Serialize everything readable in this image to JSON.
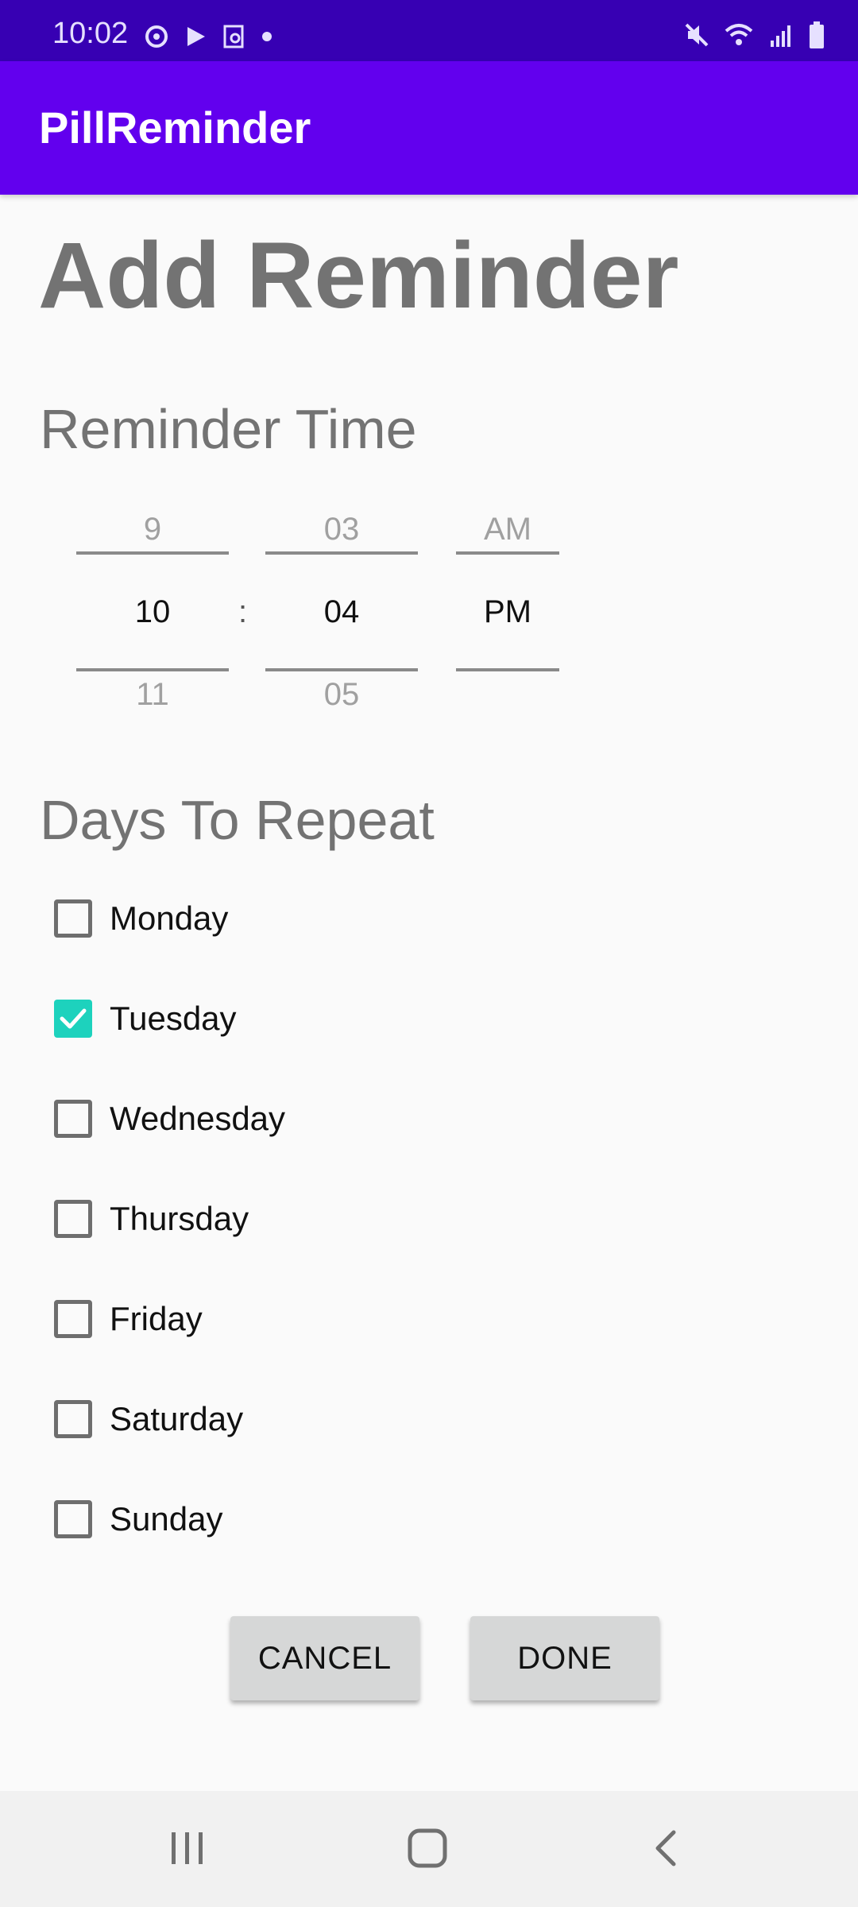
{
  "status_bar": {
    "time": "10:02",
    "icons_left": [
      "sync-icon",
      "play-store-icon",
      "screenshot-icon",
      "notification-dot-icon"
    ],
    "icons_right": [
      "mute-icon",
      "wifi-icon",
      "signal-icon",
      "battery-icon"
    ]
  },
  "app_bar": {
    "title": "PillReminder"
  },
  "page": {
    "title": "Add Reminder"
  },
  "reminder_time": {
    "section_title": "Reminder Time",
    "hour": {
      "prev": "9",
      "current": "10",
      "next": "11"
    },
    "separator": ":",
    "minute": {
      "prev": "03",
      "current": "04",
      "next": "05"
    },
    "ampm": {
      "prev": "AM",
      "current": "PM",
      "next": ""
    }
  },
  "days": {
    "section_title": "Days To Repeat",
    "items": [
      {
        "label": "Monday",
        "checked": false
      },
      {
        "label": "Tuesday",
        "checked": true
      },
      {
        "label": "Wednesday",
        "checked": false
      },
      {
        "label": "Thursday",
        "checked": false
      },
      {
        "label": "Friday",
        "checked": false
      },
      {
        "label": "Saturday",
        "checked": false
      },
      {
        "label": "Sunday",
        "checked": false
      }
    ]
  },
  "actions": {
    "cancel_label": "CANCEL",
    "done_label": "DONE"
  },
  "nav_bar": {
    "icons": [
      "recent-apps-icon",
      "home-icon",
      "back-icon"
    ]
  },
  "colors": {
    "status_bar": "#3700b3",
    "app_bar": "#6200ee",
    "checkbox_checked": "#1dd2bd",
    "button_bg": "#d6d7d7"
  }
}
